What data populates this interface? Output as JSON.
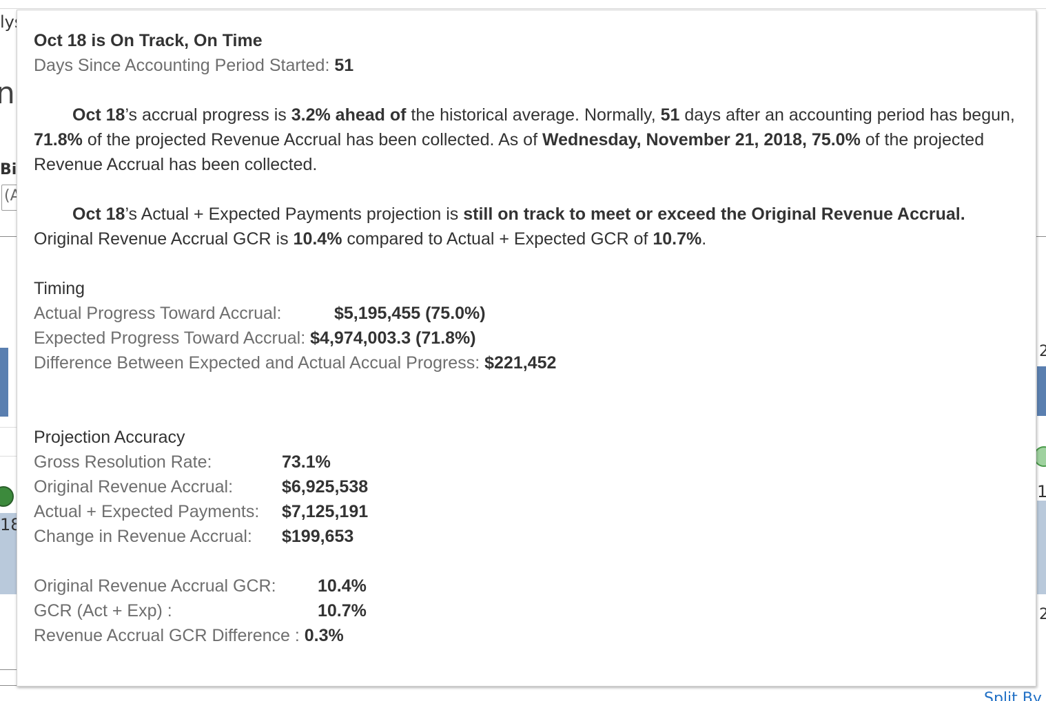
{
  "background": {
    "frag_top_left": "lys",
    "frag_mid_left": "na",
    "frag_bi": "Bi",
    "frag_dropdown": "(A",
    "frag_18": "18",
    "frag_right_2": "2",
    "frag_right_1": "1",
    "frag_right_2b": "2",
    "frag_split": "Split By"
  },
  "tooltip": {
    "title": "Oct 18 is On Track, On Time",
    "days_label": "Days Since Accounting Period Started:",
    "days_value": "51",
    "para1": {
      "period": "Oct 18",
      "t1": "’s accrual progress is ",
      "ahead": "3.2% ahead of",
      "t2": " the historical average. Normally, ",
      "days": "51",
      "t3": " days after an accounting period has begun, ",
      "expected_pct": "71.8%",
      "t4": " of the projected Revenue Accrual has been collected. As of ",
      "date_pct": "Wednesday, November 21, 2018, 75.0%",
      "t5": " of the projected Revenue Accrual has been collected."
    },
    "para2": {
      "period": "Oct 18",
      "t1": "’s Actual + Expected Payments projection is ",
      "status": "still on track to meet or exceed the Original Revenue Accrual.",
      "t2": " Original Revenue Accrual GCR is ",
      "orig_gcr": "10.4%",
      "t3": " compared to Actual + Expected GCR of ",
      "act_gcr": "10.7%",
      "t4": "."
    },
    "timing": {
      "title": "Timing",
      "rows": [
        {
          "label": "Actual Progress Toward Accrual:",
          "value": "$5,195,455 (75.0%)"
        },
        {
          "label": "Expected Progress Toward Accrual:",
          "value": "$4,974,003.3 (71.8%)"
        },
        {
          "label": "Difference Between Expected and Actual Accual Progress:",
          "value": "$221,452"
        }
      ]
    },
    "accuracy": {
      "title": "Projection Accuracy",
      "rows": [
        {
          "label": "Gross Resolution Rate:",
          "value": "73.1%"
        },
        {
          "label": "Original Revenue Accrual:",
          "value": "$6,925,538"
        },
        {
          "label": "Actual + Expected Payments:",
          "value": "$7,125,191"
        },
        {
          "label": "Change in Revenue Accrual:",
          "value": "$199,653"
        }
      ]
    },
    "gcr": {
      "rows": [
        {
          "label": "Original Revenue Accrual GCR:",
          "value": "10.4%"
        },
        {
          "label": "GCR (Act + Exp) :",
          "value": "10.7%"
        },
        {
          "label": "Revenue Accrual GCR Difference :",
          "value": "0.3%"
        }
      ]
    }
  }
}
